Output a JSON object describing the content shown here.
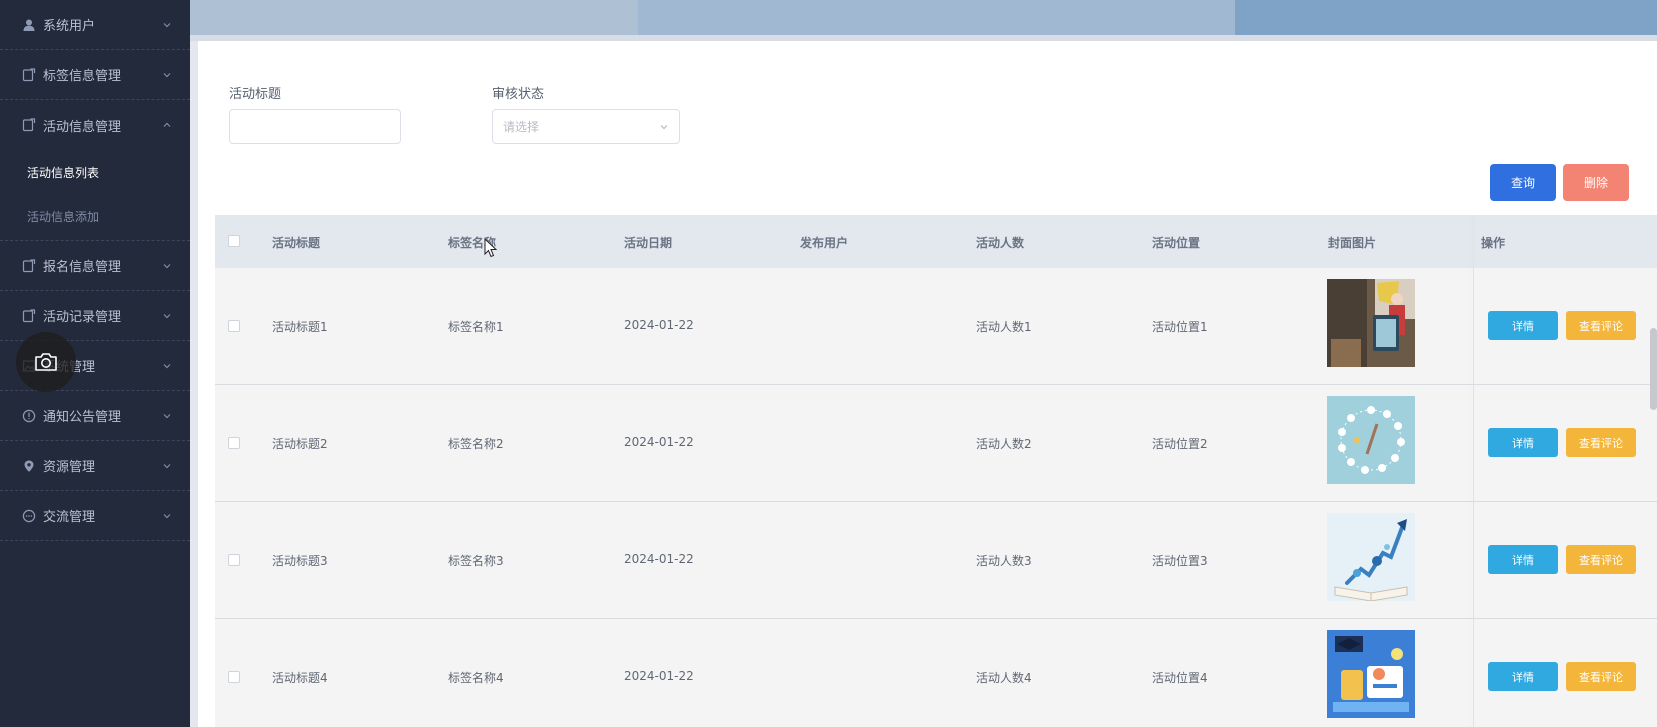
{
  "sidebar": {
    "menus": [
      {
        "label": "系统用户",
        "icon": "user-icon"
      },
      {
        "label": "标签信息管理",
        "icon": "tag-doc-icon"
      },
      {
        "label": "活动信息管理",
        "icon": "tag-doc-icon",
        "expanded": true,
        "children": [
          {
            "label": "活动信息列表",
            "active": true
          },
          {
            "label": "活动信息添加",
            "active": false
          }
        ]
      },
      {
        "label": "报名信息管理",
        "icon": "tag-doc-icon"
      },
      {
        "label": "活动记录管理",
        "icon": "tag-doc-icon"
      },
      {
        "label": "系统管理",
        "icon": "image-icon"
      },
      {
        "label": "通知公告管理",
        "icon": "info-circle-icon"
      },
      {
        "label": "资源管理",
        "icon": "location-pin-icon"
      },
      {
        "label": "交流管理",
        "icon": "chat-icon"
      }
    ]
  },
  "search": {
    "title_label": "活动标题",
    "title_value": "",
    "status_label": "审核状态",
    "status_placeholder": "请选择"
  },
  "actions": {
    "query": "查询",
    "delete": "删除"
  },
  "table": {
    "columns": [
      "活动标题",
      "标签名称",
      "活动日期",
      "发布用户",
      "活动人数",
      "活动位置",
      "封面图片",
      "操作"
    ],
    "rows": [
      {
        "title": "活动标题1",
        "tag": "标签名称1",
        "date": "2024-01-22",
        "user": "",
        "count": "活动人数1",
        "location": "活动位置1"
      },
      {
        "title": "活动标题2",
        "tag": "标签名称2",
        "date": "2024-01-22",
        "user": "",
        "count": "活动人数2",
        "location": "活动位置2"
      },
      {
        "title": "活动标题3",
        "tag": "标签名称3",
        "date": "2024-01-22",
        "user": "",
        "count": "活动人数3",
        "location": "活动位置3"
      },
      {
        "title": "活动标题4",
        "tag": "标签名称4",
        "date": "2024-01-22",
        "user": "",
        "count": "活动人数4",
        "location": "活动位置4"
      }
    ],
    "row_actions": {
      "detail": "详情",
      "comment": "查看评论"
    }
  },
  "colors": {
    "sidebar_bg": "#232a3b",
    "query_btn": "#2f6fe0",
    "delete_btn": "#f38373",
    "detail_btn": "#2fa9e0",
    "comment_btn": "#f3b53a"
  }
}
